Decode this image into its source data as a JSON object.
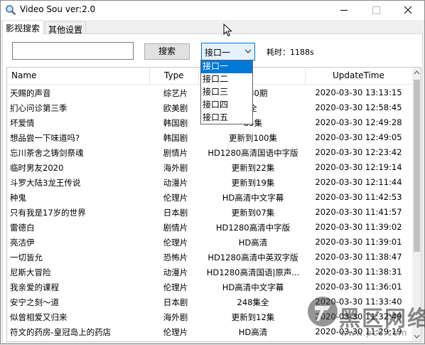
{
  "window": {
    "title": "Video Sou ver:2.0"
  },
  "tabs": [
    {
      "label": "影视搜索"
    },
    {
      "label": "其他设置"
    }
  ],
  "search": {
    "value": "",
    "button_label": "搜索"
  },
  "api_select": {
    "selected": "接口一",
    "options": [
      "接口一",
      "接口二",
      "接口三",
      "接口四",
      "接口五"
    ]
  },
  "elapsed_label": "耗时：1188s",
  "table": {
    "columns": [
      "Name",
      "Type",
      "UpdateTime"
    ],
    "rows": [
      {
        "name": "天赐的声音",
        "type": "综艺片",
        "update": "0330期",
        "time": "2020-03-30 13:13:15"
      },
      {
        "name": "扪心问诊第三季",
        "type": "欧美剧",
        "update": "全",
        "time": "2020-03-30 12:58:45"
      },
      {
        "name": "坏爱情",
        "type": "韩国剧",
        "update": "85集",
        "time": "2020-03-30 12:49:28"
      },
      {
        "name": "想品尝一下味道吗?",
        "type": "韩国剧",
        "update": "更新到100集",
        "time": "2020-03-30 12:49:05"
      },
      {
        "name": "忘川茶舍之铸剑祭魂",
        "type": "剧情片",
        "update": "HD1280高清国语中字版",
        "time": "2020-03-30 12:23:42"
      },
      {
        "name": "临时男友2020",
        "type": "海外剧",
        "update": "更新到22集",
        "time": "2020-03-30 12:19:14"
      },
      {
        "name": "斗罗大陆3龙王传说",
        "type": "动漫片",
        "update": "更新到19集",
        "time": "2020-03-30 12:11:44"
      },
      {
        "name": "种鬼",
        "type": "伦理片",
        "update": "HD高清中文字幕",
        "time": "2020-03-30 11:42:53"
      },
      {
        "name": "只有我是17岁的世界",
        "type": "日本剧",
        "update": "更新到07集",
        "time": "2020-03-30 11:41:57"
      },
      {
        "name": "雷德白",
        "type": "剧情片",
        "update": "HD1280高清中字版",
        "time": "2020-03-30 11:39:02"
      },
      {
        "name": "亮洁伊",
        "type": "伦理片",
        "update": "HD高清",
        "time": "2020-03-30 11:39:01"
      },
      {
        "name": "一切皆允",
        "type": "恐怖片",
        "update": "HD1280高清中英双字版",
        "time": "2020-03-30 11:38:47"
      },
      {
        "name": "尼斯大冒险",
        "type": "动漫片",
        "update": "HD1280高清国语|原声...",
        "time": "2020-03-30 11:38:31"
      },
      {
        "name": "我亲爱的课程",
        "type": "伦理片",
        "update": "HD高清中文字幕",
        "time": "2020-03-30 11:36:01"
      },
      {
        "name": "安宁之刻～道",
        "type": "日本剧",
        "update": "248集全",
        "time": "2020-03-30 11:33:40"
      },
      {
        "name": "似曾相爱又归来",
        "type": "海外剧",
        "update": "更新到12集",
        "time": "2020-03-30 11:32:49"
      },
      {
        "name": "符文的药房-皇冠岛上的药店",
        "type": "伦理片",
        "update": "HD高清",
        "time": "2020-03-30 11:29:19"
      }
    ]
  },
  "watermark": {
    "text": "黑区网络",
    "sub": "www.pc6.com"
  }
}
